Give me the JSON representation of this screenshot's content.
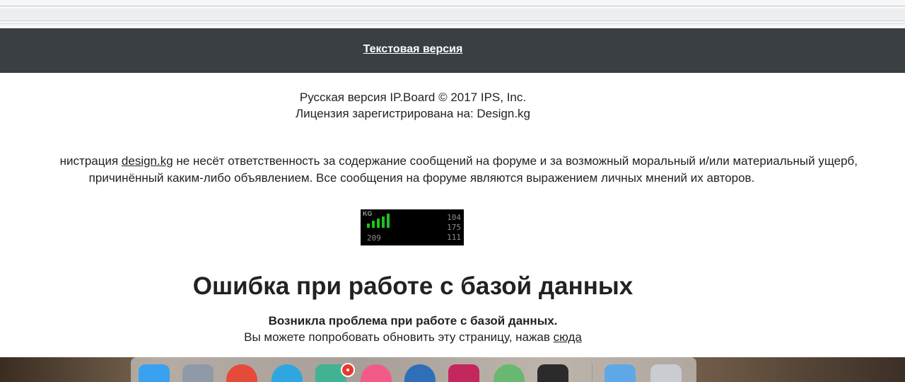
{
  "navbar": {
    "text_version_link": "Текстовая версия"
  },
  "footer": {
    "copyright_line1": "Русская версия IP.Board © 2017  IPS, Inc.",
    "copyright_line2": "Лицензия зарегистрирована на: Design.kg",
    "disclaimer_prefix": "нистрация ",
    "disclaimer_link": "design.kg",
    "disclaimer_line1_rest": " не несёт ответственность за содержание сообщений на форуме и за возможный моральный и/или материальный ущерб,",
    "disclaimer_line2": "причинённый каким-либо объявлением. Все сообщения на форуме являются выражением личных мнений их авторов."
  },
  "counter": {
    "brand": "KG",
    "value_total": "209",
    "value_1": "104",
    "value_2": "175",
    "value_3": "111",
    "bar_color": "#1fc21f"
  },
  "error": {
    "title": "Ошибка при работе с базой данных",
    "subtitle": "Возникла проблема при работе с базой данных.",
    "message": "Вы можете попробовать обновить эту страницу, нажав ",
    "link": "сюда"
  },
  "dock": {
    "apps": [
      {
        "name": "finder-icon",
        "color": "#3aa0f0"
      },
      {
        "name": "launchpad-icon",
        "color": "#8e9aa8"
      },
      {
        "name": "chrome-icon",
        "color": "#e64a3b"
      },
      {
        "name": "telegram-icon",
        "color": "#2ea6e0"
      },
      {
        "name": "slack-icon",
        "color": "#41b392"
      },
      {
        "name": "itunes-icon",
        "color": "#f25a88"
      },
      {
        "name": "thunderbird-icon",
        "color": "#2e6fb8"
      },
      {
        "name": "intellij-icon",
        "color": "#c4275d"
      },
      {
        "name": "atom-icon",
        "color": "#69b86f"
      },
      {
        "name": "terminal-icon",
        "color": "#2b2b2b"
      },
      {
        "name": "folder-icon",
        "color": "#5fa8e8"
      },
      {
        "name": "trash-icon",
        "color": "#c9ccd0"
      }
    ],
    "badge_color": "#e8382f"
  }
}
